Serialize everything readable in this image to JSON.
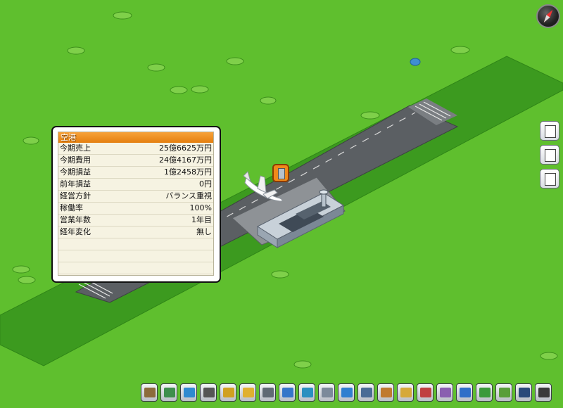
{
  "panel": {
    "title": "空港",
    "rows": [
      {
        "label": "今期売上",
        "value": "25億6625万円"
      },
      {
        "label": "今期費用",
        "value": "24億4167万円"
      },
      {
        "label": "今期損益",
        "value": "1億2458万円"
      },
      {
        "label": "前年損益",
        "value": "0円"
      },
      {
        "label": "経営方針",
        "value": "バランス重視"
      },
      {
        "label": "稼働率",
        "value": "100%"
      },
      {
        "label": "営業年数",
        "value": "1年目"
      },
      {
        "label": "経年変化",
        "value": "無し"
      }
    ]
  },
  "side_buttons": [
    {
      "icon": "clipboard-list-icon"
    },
    {
      "icon": "documents-icon"
    },
    {
      "icon": "map-edit-icon"
    }
  ],
  "toolbar": [
    {
      "icon": "rail-track-icon",
      "color": "#8c6b3a"
    },
    {
      "icon": "train-icon",
      "color": "#3e8f4d"
    },
    {
      "icon": "bus-icon",
      "color": "#2e8ad1"
    },
    {
      "icon": "road-icon",
      "color": "#555555"
    },
    {
      "icon": "truck-icon",
      "color": "#d0a020"
    },
    {
      "icon": "vehicle-icon",
      "color": "#e0b030"
    },
    {
      "icon": "highway-icon",
      "color": "#606a74"
    },
    {
      "icon": "station-icon",
      "color": "#3576c9"
    },
    {
      "icon": "ropeway-icon",
      "color": "#2a90c0"
    },
    {
      "icon": "building-icon",
      "color": "#7c8a9a"
    },
    {
      "icon": "elevation-icon",
      "color": "#2f7fd0"
    },
    {
      "icon": "office-building-icon",
      "color": "#4a6c96"
    },
    {
      "icon": "package-icon",
      "color": "#c07a30"
    },
    {
      "icon": "money-person-icon",
      "color": "#d6a93a"
    },
    {
      "icon": "graph-icon",
      "color": "#c04040"
    },
    {
      "icon": "calendar-icon",
      "color": "#8a5fb0"
    },
    {
      "icon": "settings-gear-icon",
      "color": "#2f6fc8"
    },
    {
      "icon": "terrain-icon",
      "color": "#3a9a3a"
    },
    {
      "icon": "pointer-icon",
      "color": "#5a9e3a"
    },
    {
      "icon": "staff-icon",
      "color": "#2a4a7a"
    },
    {
      "icon": "printer-icon",
      "color": "#3a3a3a"
    }
  ],
  "colors": {
    "grass": "#5fbf2e",
    "dark_grass": "#3c9a1f",
    "runway": "#5b5f63",
    "panel_title": "#f08a1a"
  }
}
